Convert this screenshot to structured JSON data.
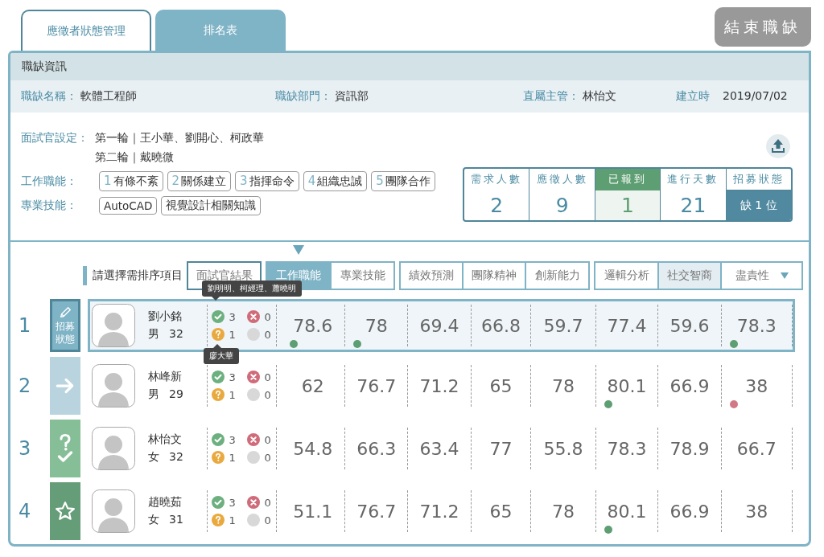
{
  "tabs": [
    {
      "label": "應徵者狀態管理",
      "selected": true
    },
    {
      "label": "排名表",
      "selected": false
    }
  ],
  "end_button": "結束職缺",
  "job_info": {
    "title": "職缺資訊",
    "fields": [
      {
        "label": "職缺名稱：",
        "value": "軟體工程師"
      },
      {
        "label": "職缺部門：",
        "value": "資訊部"
      },
      {
        "label": "直屬主管：",
        "value": "林怡文"
      },
      {
        "label": "建立時",
        "value": "2019/07/02"
      }
    ],
    "interviewers": {
      "label": "面試官設定：",
      "rounds": [
        "第一輪｜王小華、劉開心、柯政華",
        "第二輪｜戴曉微"
      ]
    },
    "functions": {
      "label": "工作職能：",
      "tags": [
        {
          "num": "1",
          "text": "有條不紊"
        },
        {
          "num": "2",
          "text": "關係建立"
        },
        {
          "num": "3",
          "text": "指揮命令"
        },
        {
          "num": "4",
          "text": "組織忠誠"
        },
        {
          "num": "5",
          "text": "團隊合作"
        }
      ]
    },
    "skills": {
      "label": "專業技能：",
      "tags": [
        "AutoCAD",
        "視覺設計相關知識"
      ]
    },
    "stats": [
      {
        "label": "需求人數",
        "value": "2",
        "kind": "plain"
      },
      {
        "label": "應徵人數",
        "value": "9",
        "kind": "plain"
      },
      {
        "label": "已報到",
        "value": "1",
        "kind": "highlight"
      },
      {
        "label": "進行天數",
        "value": "21",
        "kind": "plain"
      },
      {
        "label": "招募狀態",
        "value": "缺 1 位",
        "kind": "status"
      }
    ]
  },
  "sort": {
    "label": "請選擇需排序項目",
    "groups": [
      {
        "emphasized": true,
        "items": [
          {
            "label": "面試官結果",
            "selected": false,
            "shaded": false,
            "dropdown": false
          }
        ]
      },
      {
        "emphasized": false,
        "items": [
          {
            "label": "工作職能",
            "selected": true,
            "shaded": false,
            "dropdown": false
          },
          {
            "label": "專業技能",
            "selected": false,
            "shaded": false,
            "dropdown": false
          }
        ]
      },
      {
        "emphasized": false,
        "items": [
          {
            "label": "績效預測",
            "selected": false,
            "shaded": false,
            "dropdown": false
          },
          {
            "label": "團隊精神",
            "selected": false,
            "shaded": false,
            "dropdown": false
          },
          {
            "label": "創新能力",
            "selected": false,
            "shaded": false,
            "dropdown": false
          }
        ]
      },
      {
        "emphasized": false,
        "items": [
          {
            "label": "邏輯分析",
            "selected": false,
            "shaded": false,
            "dropdown": false
          },
          {
            "label": "社交智商",
            "selected": false,
            "shaded": true,
            "dropdown": false
          },
          {
            "label": "盡責性",
            "selected": false,
            "shaded": false,
            "dropdown": true
          }
        ]
      }
    ]
  },
  "rows": [
    {
      "rank": "1",
      "selected": true,
      "status": {
        "kind": "edit",
        "label": "招募狀態"
      },
      "name": "劉小銘",
      "gender": "男",
      "age": "32",
      "interview": {
        "pass": "3",
        "fail": "0",
        "pending": "1",
        "none": "0",
        "pass_tooltip": "劉明明、柯經理、蕭曉明",
        "pending_tooltip": "廖大華"
      },
      "scores": [
        {
          "value": "78.6",
          "color": "#5e9e73"
        },
        {
          "value": "78",
          "color": "#5e9e73"
        },
        {
          "value": "69.4"
        },
        {
          "value": "66.8"
        },
        {
          "value": "59.7"
        },
        {
          "value": "77.4"
        },
        {
          "value": "59.6"
        },
        {
          "value": "78.3",
          "color": "#5e9e73"
        }
      ]
    },
    {
      "rank": "2",
      "selected": false,
      "status": {
        "kind": "arrow"
      },
      "name": "林峰新",
      "gender": "男",
      "age": "29",
      "interview": {
        "pass": "3",
        "fail": "0",
        "pending": "1",
        "none": "0"
      },
      "scores": [
        {
          "value": "62"
        },
        {
          "value": "76.7"
        },
        {
          "value": "71.2"
        },
        {
          "value": "65"
        },
        {
          "value": "78"
        },
        {
          "value": "80.1",
          "color": "#5e9e73"
        },
        {
          "value": "66.9"
        },
        {
          "value": "38",
          "color": "#d07a84"
        }
      ]
    },
    {
      "rank": "3",
      "selected": false,
      "status": {
        "kind": "pending"
      },
      "name": "林怡文",
      "gender": "女",
      "age": "32",
      "interview": {
        "pass": "3",
        "fail": "0",
        "pending": "1",
        "none": "0"
      },
      "scores": [
        {
          "value": "54.8"
        },
        {
          "value": "66.3"
        },
        {
          "value": "63.4"
        },
        {
          "value": "77"
        },
        {
          "value": "55.8"
        },
        {
          "value": "78.3"
        },
        {
          "value": "78.9"
        },
        {
          "value": "66.7"
        }
      ]
    },
    {
      "rank": "4",
      "selected": false,
      "status": {
        "kind": "star"
      },
      "name": "趙曉茹",
      "gender": "女",
      "age": "31",
      "interview": {
        "pass": "3",
        "fail": "0",
        "pending": "1",
        "none": "0"
      },
      "scores": [
        {
          "value": "51.1"
        },
        {
          "value": "76.7"
        },
        {
          "value": "71.2"
        },
        {
          "value": "65"
        },
        {
          "value": "78"
        },
        {
          "value": "80.1",
          "color": "#5e9e73"
        },
        {
          "value": "66.9"
        },
        {
          "value": "38"
        }
      ]
    }
  ]
}
